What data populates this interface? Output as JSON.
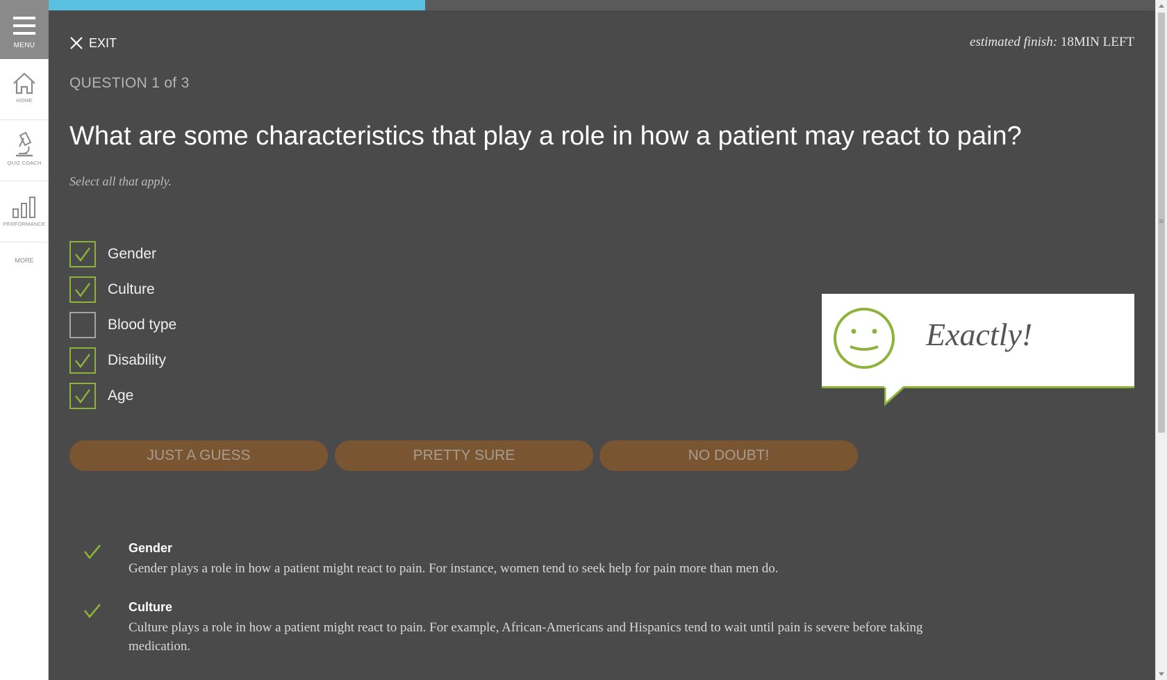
{
  "sidebar": {
    "menu_label": "MENU",
    "items": [
      {
        "label": "HOME",
        "icon": "home-icon"
      },
      {
        "label": "QUIZ COACH",
        "icon": "microscope-icon"
      },
      {
        "label": "PERFORMANCE",
        "icon": "bar-chart-icon"
      }
    ],
    "more_label": "MORE"
  },
  "progress": {
    "fraction": 0.34,
    "color": "#5bbfe0"
  },
  "header": {
    "exit_label": "EXIT",
    "finish_prefix": "estimated finish:",
    "finish_value": "18MIN LEFT"
  },
  "question": {
    "counter": "QUESTION 1 of 3",
    "text": "What are some characteristics that play a role in how a patient may react to pain?",
    "instructions": "Select all that apply."
  },
  "options": [
    {
      "label": "Gender",
      "checked": true
    },
    {
      "label": "Culture",
      "checked": true
    },
    {
      "label": "Blood type",
      "checked": false
    },
    {
      "label": "Disability",
      "checked": true
    },
    {
      "label": "Age",
      "checked": true
    }
  ],
  "feedback": {
    "text": "Exactly!",
    "icon": "smiley-face-icon",
    "color": "#8db33a"
  },
  "confidence_buttons": [
    "JUST A GUESS",
    "PRETTY SURE",
    "NO DOUBT!"
  ],
  "explanations": [
    {
      "title": "Gender",
      "body": "Gender plays a role in how a patient might react to pain. For instance, women tend to seek help for pain more than men do."
    },
    {
      "title": "Culture",
      "body": "Culture plays a role in how a patient might react to pain. For example, African-Americans and Hispanics tend to wait until pain is severe before taking medication."
    }
  ],
  "colors": {
    "background": "#4a4a4a",
    "accent_green": "#8db33a",
    "confidence_button": "#7a5532",
    "progress": "#5bbfe0"
  }
}
